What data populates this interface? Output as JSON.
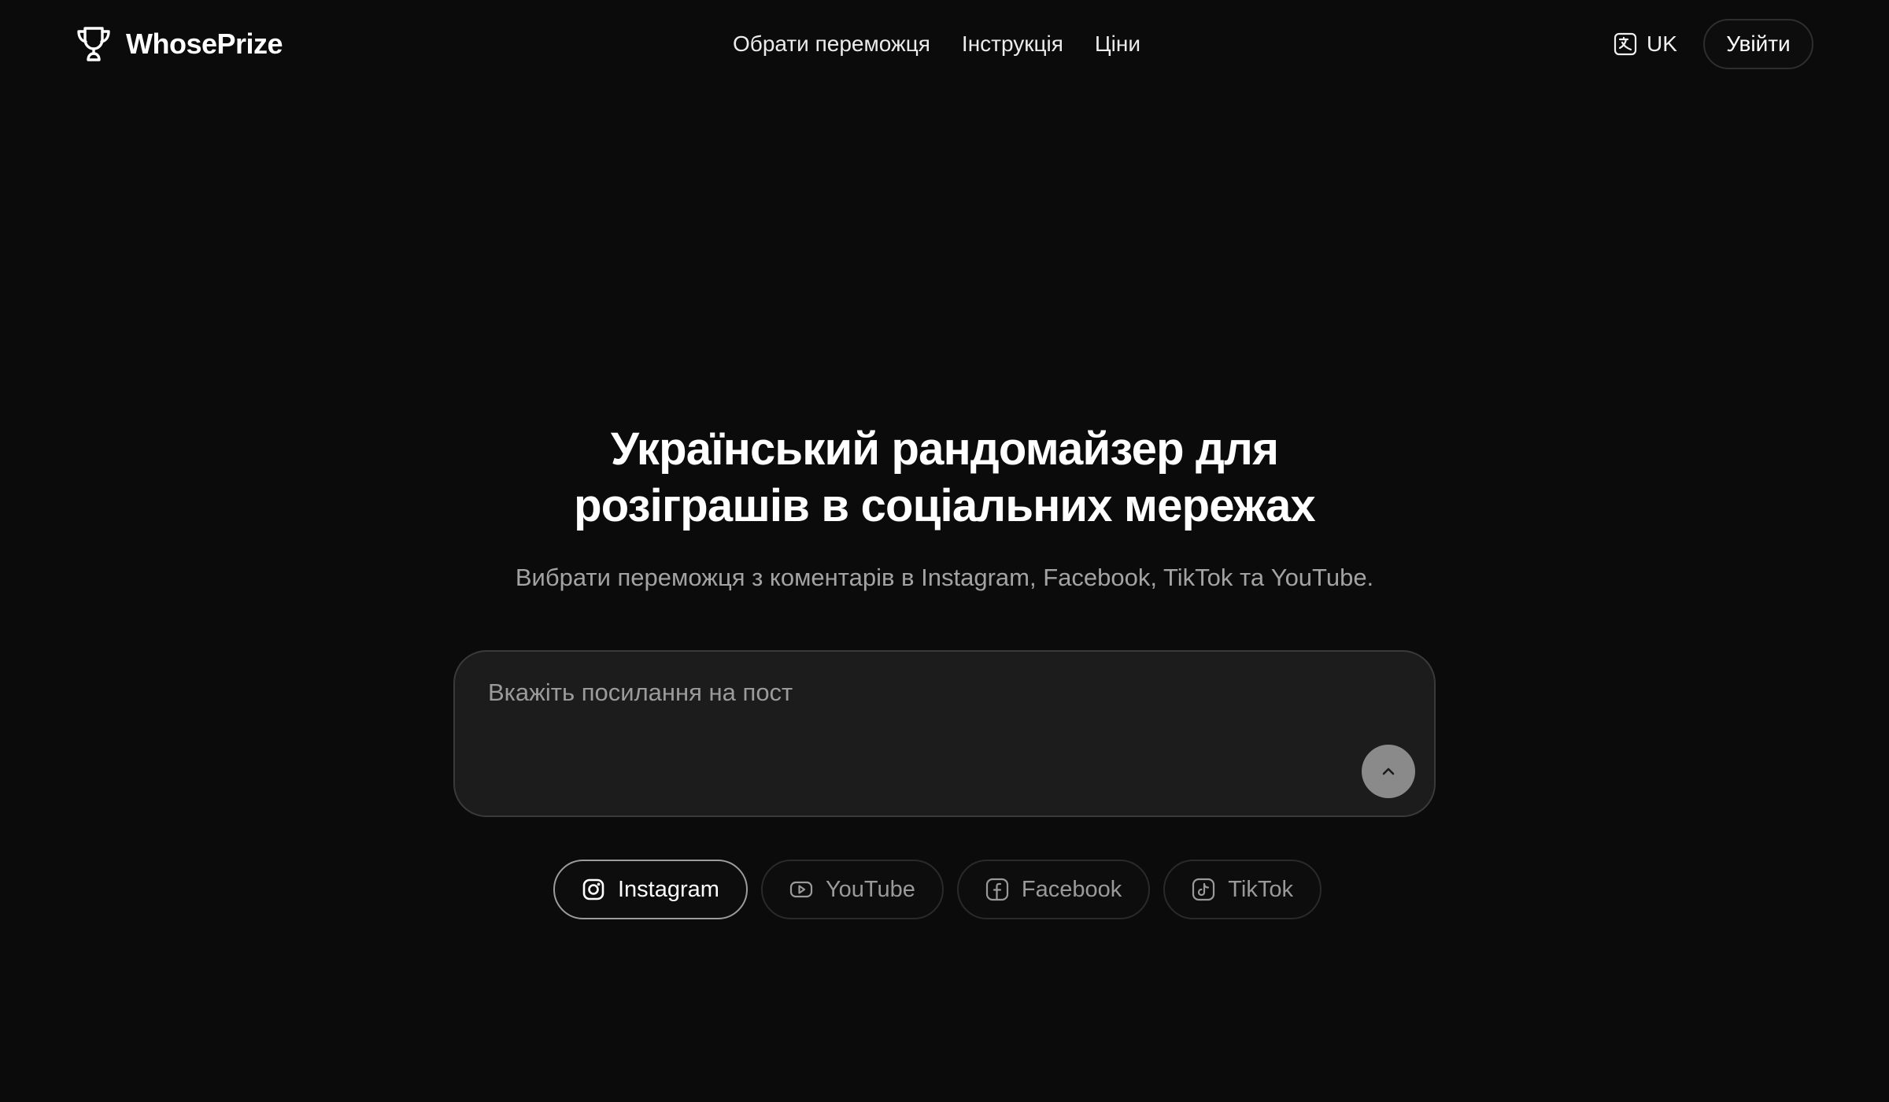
{
  "header": {
    "brand": "WhosePrize",
    "brand_icon": "trophy-icon",
    "nav": [
      {
        "label": "Обрати переможця"
      },
      {
        "label": "Інструкція"
      },
      {
        "label": "Ціни"
      }
    ],
    "language": {
      "label": "UK",
      "icon": "translate-icon"
    },
    "login_label": "Увійти"
  },
  "hero": {
    "title_line1": "Український рандомайзер для",
    "title_line2": "розіграшів в соціальних мережах",
    "subtitle": "Вибрати переможця з коментарів в Instagram, Facebook, TikTok та YouTube."
  },
  "post_input": {
    "placeholder": "Вкажіть посилання на пост",
    "value": "",
    "submit_icon": "chevron-up-icon"
  },
  "platforms": [
    {
      "label": "Instagram",
      "icon": "instagram-icon",
      "selected": true
    },
    {
      "label": "YouTube",
      "icon": "youtube-icon",
      "selected": false
    },
    {
      "label": "Facebook",
      "icon": "facebook-icon",
      "selected": false
    },
    {
      "label": "TikTok",
      "icon": "tiktok-icon",
      "selected": false
    }
  ],
  "colors": {
    "background": "#0b0b0b",
    "card": "#1c1c1c",
    "muted_text": "#a3a3a3",
    "submit_button": "#8a8a8a"
  }
}
